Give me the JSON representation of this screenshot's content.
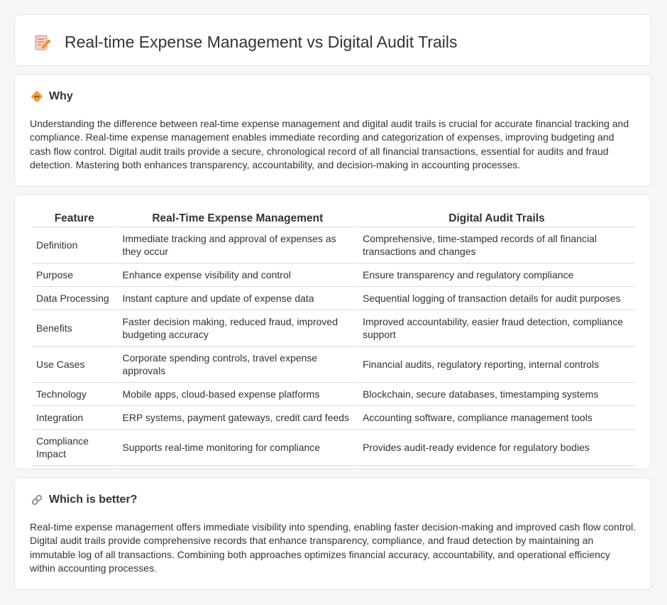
{
  "header": {
    "title": "Real-time Expense Management vs Digital Audit Trails",
    "icon": "pencil-note-icon"
  },
  "why": {
    "title": "Why",
    "icon": "diamond-sign-icon",
    "text": "Understanding the difference between real-time expense management and digital audit trails is crucial for accurate financial tracking and compliance. Real-time expense management enables immediate recording and categorization of expenses, improving budgeting and cash flow control. Digital audit trails provide a secure, chronological record of all financial transactions, essential for audits and fraud detection. Mastering both enhances transparency, accountability, and decision-making in accounting processes."
  },
  "table": {
    "headers": [
      "Feature",
      "Real-Time Expense Management",
      "Digital Audit Trails"
    ],
    "rows": [
      [
        "Definition",
        "Immediate tracking and approval of expenses as they occur",
        "Comprehensive, time-stamped records of all financial transactions and changes"
      ],
      [
        "Purpose",
        "Enhance expense visibility and control",
        "Ensure transparency and regulatory compliance"
      ],
      [
        "Data Processing",
        "Instant capture and update of expense data",
        "Sequential logging of transaction details for audit purposes"
      ],
      [
        "Benefits",
        "Faster decision making, reduced fraud, improved budgeting accuracy",
        "Improved accountability, easier fraud detection, compliance support"
      ],
      [
        "Use Cases",
        "Corporate spending controls, travel expense approvals",
        "Financial audits, regulatory reporting, internal controls"
      ],
      [
        "Technology",
        "Mobile apps, cloud-based expense platforms",
        "Blockchain, secure databases, timestamping systems"
      ],
      [
        "Integration",
        "ERP systems, payment gateways, credit card feeds",
        "Accounting software, compliance management tools"
      ],
      [
        "Compliance Impact",
        "Supports real-time monitoring for compliance",
        "Provides audit-ready evidence for regulatory bodies"
      ]
    ]
  },
  "better": {
    "title": "Which is better?",
    "icon": "link-icon",
    "text": "Real-time expense management offers immediate visibility into spending, enabling faster decision-making and improved cash flow control. Digital audit trails provide comprehensive records that enhance transparency, compliance, and fraud detection by maintaining an immutable log of all transactions. Combining both approaches optimizes financial accuracy, accountability, and operational efficiency within accounting processes."
  },
  "colors": {
    "background": "#f5f6f8",
    "card": "#ffffff",
    "border": "#e1e4e8",
    "text": "#333333",
    "accent_orange": "#f0a030"
  }
}
